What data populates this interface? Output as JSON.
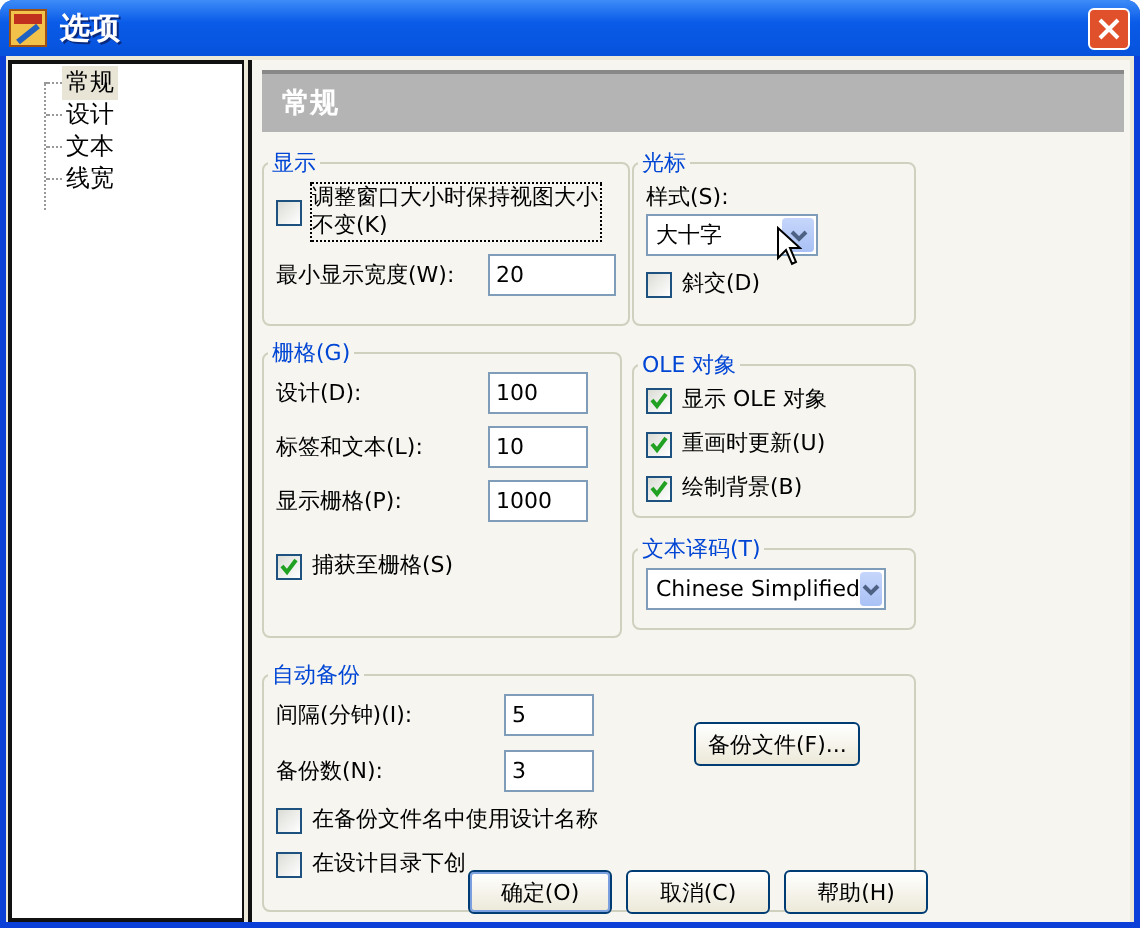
{
  "window": {
    "title": "选项"
  },
  "tree": [
    {
      "label": "常规",
      "selected": true
    },
    {
      "label": "设计",
      "selected": false
    },
    {
      "label": "文本",
      "selected": false
    },
    {
      "label": "线宽",
      "selected": false
    }
  ],
  "page": {
    "title": "常规"
  },
  "display": {
    "legend": "显示",
    "keep_view": {
      "label": "调整窗口大小时保持视图大小不变(K)",
      "checked": false,
      "focused": true
    },
    "min_width": {
      "label": "最小显示宽度(W):",
      "value": "20"
    }
  },
  "cursor": {
    "legend": "光标",
    "style_label": "样式(S):",
    "style_value": "大十字",
    "diagonal": {
      "label": "斜交(D)",
      "checked": false
    }
  },
  "grid": {
    "legend": "栅格(G)",
    "fields": [
      {
        "label": "设计(D):",
        "value": "100"
      },
      {
        "label": "标签和文本(L):",
        "value": "10"
      },
      {
        "label": "显示栅格(P):",
        "value": "1000"
      }
    ],
    "snap": {
      "label": "捕获至栅格(S)",
      "checked": true
    }
  },
  "ole": {
    "legend": "OLE 对象",
    "options": [
      {
        "label": "显示 OLE 对象",
        "checked": true
      },
      {
        "label": "重画时更新(U)",
        "checked": true
      },
      {
        "label": "绘制背景(B)",
        "checked": true
      }
    ]
  },
  "encoding": {
    "legend": "文本译码(T)",
    "value": "Chinese Simplified"
  },
  "backup": {
    "legend": "自动备份",
    "fields": [
      {
        "label": "间隔(分钟)(I):",
        "value": "5"
      },
      {
        "label": "备份数(N):",
        "value": "3"
      }
    ],
    "button": "备份文件(F)...",
    "options": [
      {
        "label": "在备份文件名中使用设计名称",
        "checked": false
      },
      {
        "label": "在设计目录下创",
        "checked": false
      }
    ]
  },
  "buttons": [
    {
      "label": "确定(O)",
      "default": true
    },
    {
      "label": "取消(C)",
      "default": false
    },
    {
      "label": "帮助(H)",
      "default": false
    }
  ]
}
